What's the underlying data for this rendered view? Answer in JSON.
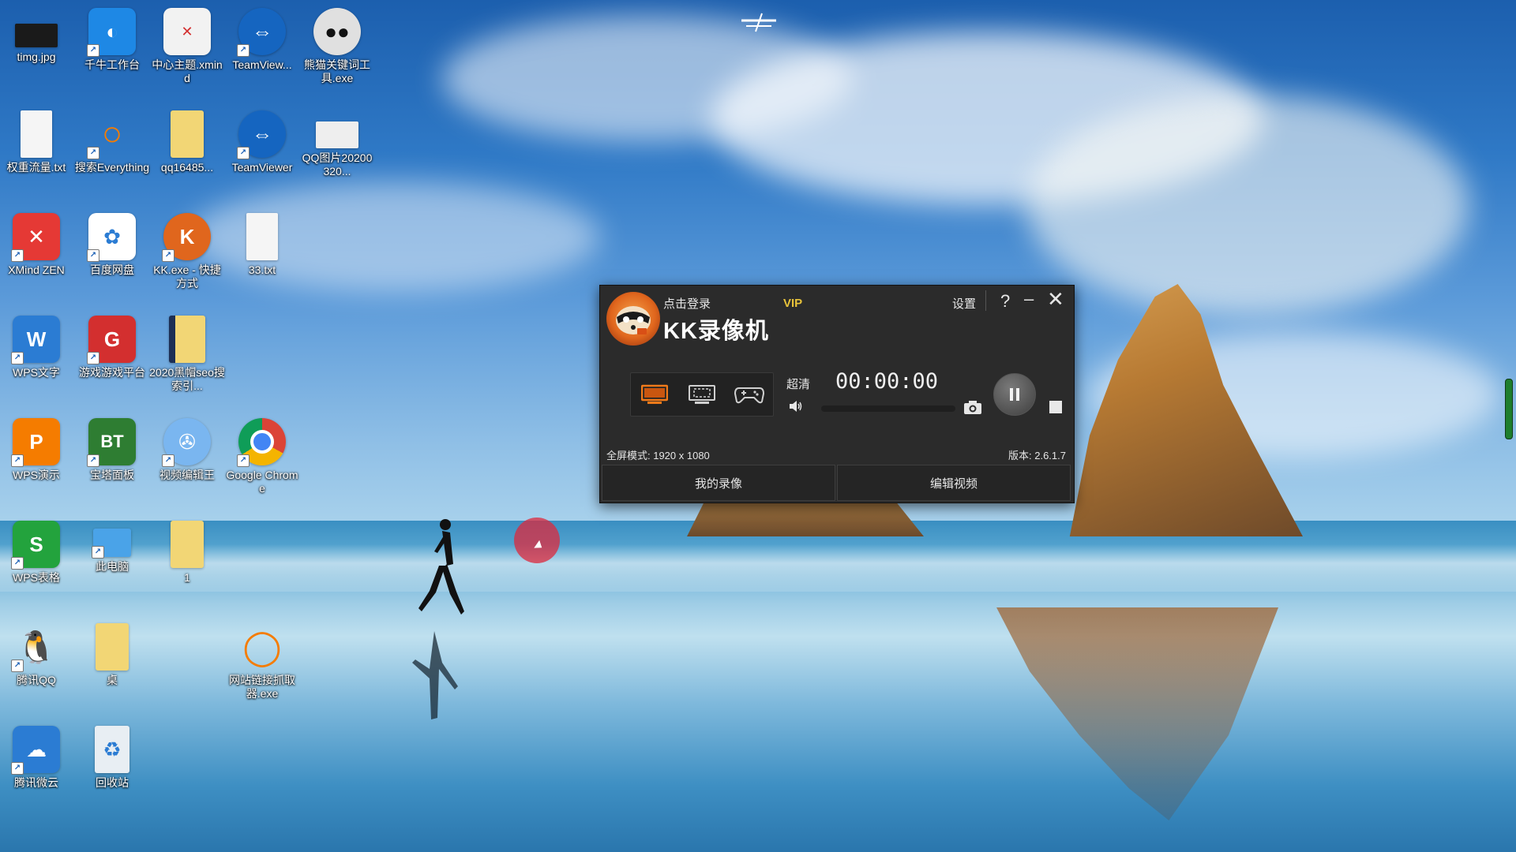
{
  "desktop": {
    "icons": [
      {
        "label": "timg.jpg",
        "icon": "image-thumbnail-icon",
        "color": "#1a1a1a"
      },
      {
        "label": "千牛工作台",
        "icon": "qianniu-icon",
        "color": "#1e88e5"
      },
      {
        "label": "中心主题.xmind",
        "icon": "xmind-file-icon",
        "color": "#f2f2f2"
      },
      {
        "label": "TeamView...",
        "icon": "teamviewer-icon",
        "color": "#1565c0"
      },
      {
        "label": "熊猫关键词工具.exe",
        "icon": "panda-icon",
        "color": "#e0e0e0"
      },
      {
        "label": "权重流量.txt",
        "icon": "text-file-icon",
        "color": "#f5f5f5"
      },
      {
        "label": "搜索Everything",
        "icon": "everything-search-icon",
        "color": "#f57c00"
      },
      {
        "label": "qq16485...",
        "icon": "folder-icon",
        "color": "#f2d675"
      },
      {
        "label": "TeamViewer",
        "icon": "teamviewer-icon",
        "color": "#1565c0"
      },
      {
        "label": "QQ图片20200320...",
        "icon": "image-file-icon",
        "color": "#eeeeee"
      },
      {
        "label": "XMind ZEN",
        "icon": "xmind-zen-icon",
        "color": "#e53935"
      },
      {
        "label": "百度网盘",
        "icon": "baidu-netdisk-icon",
        "color": "#ffffff"
      },
      {
        "label": "KK.exe - 快捷方式",
        "icon": "kk-raccoon-icon",
        "color": "#e0661d"
      },
      {
        "label": "33.txt",
        "icon": "text-file-icon",
        "color": "#f5f5f5"
      },
      {
        "label": "WPS文字",
        "icon": "wps-writer-icon",
        "color": "#2b7cd3"
      },
      {
        "label": "游戏游戏平台",
        "icon": "game-platform-icon",
        "color": "#d32f2f"
      },
      {
        "label": "2020黑帽seo搜索引...",
        "icon": "book-file-icon",
        "color": "#f2d675"
      },
      {
        "label": "WPS演示",
        "icon": "wps-presentation-icon",
        "color": "#f57c00"
      },
      {
        "label": "宝塔面板",
        "icon": "bt-panel-icon",
        "color": "#2e7d32"
      },
      {
        "label": "视频编辑王",
        "icon": "video-editor-icon",
        "color": "#7ab6f0"
      },
      {
        "label": "Google Chrome",
        "icon": "chrome-icon",
        "color": "#ffffff"
      },
      {
        "label": "WPS表格",
        "icon": "wps-spreadsheet-icon",
        "color": "#23a33d"
      },
      {
        "label": "此电脑",
        "icon": "this-pc-icon",
        "color": "#4aa3e8"
      },
      {
        "label": "1",
        "icon": "folder-icon",
        "color": "#f2d675"
      },
      {
        "label": "腾讯QQ",
        "icon": "qq-penguin-icon",
        "color": "#ffffff"
      },
      {
        "label": "桌",
        "icon": "folder-icon",
        "color": "#f2d675"
      },
      {
        "label": "网站链接抓取器.exe",
        "icon": "link-grabber-icon",
        "color": "#f57c00"
      },
      {
        "label": "腾讯微云",
        "icon": "weiyun-icon",
        "color": "#2b7cd3"
      },
      {
        "label": "回收站",
        "icon": "recycle-bin-icon",
        "color": "#e8eef3"
      }
    ]
  },
  "kk_window": {
    "login_label": "点击登录",
    "vip_label": "VIP",
    "title": "KK录像机",
    "settings_label": "设置",
    "help_label": "?",
    "minimize_label": "–",
    "close_label": "✕",
    "quality_label": "超清",
    "timer": "00:00:00",
    "mode_text": "全屏模式: 1920 x 1080",
    "version_text": "版本: 2.6.1.7",
    "my_recordings_label": "我的录像",
    "edit_video_label": "编辑视频",
    "colors": {
      "accent": "#e8c33a",
      "active_mode": "#f07a1a",
      "background": "#2b2b2b"
    }
  }
}
